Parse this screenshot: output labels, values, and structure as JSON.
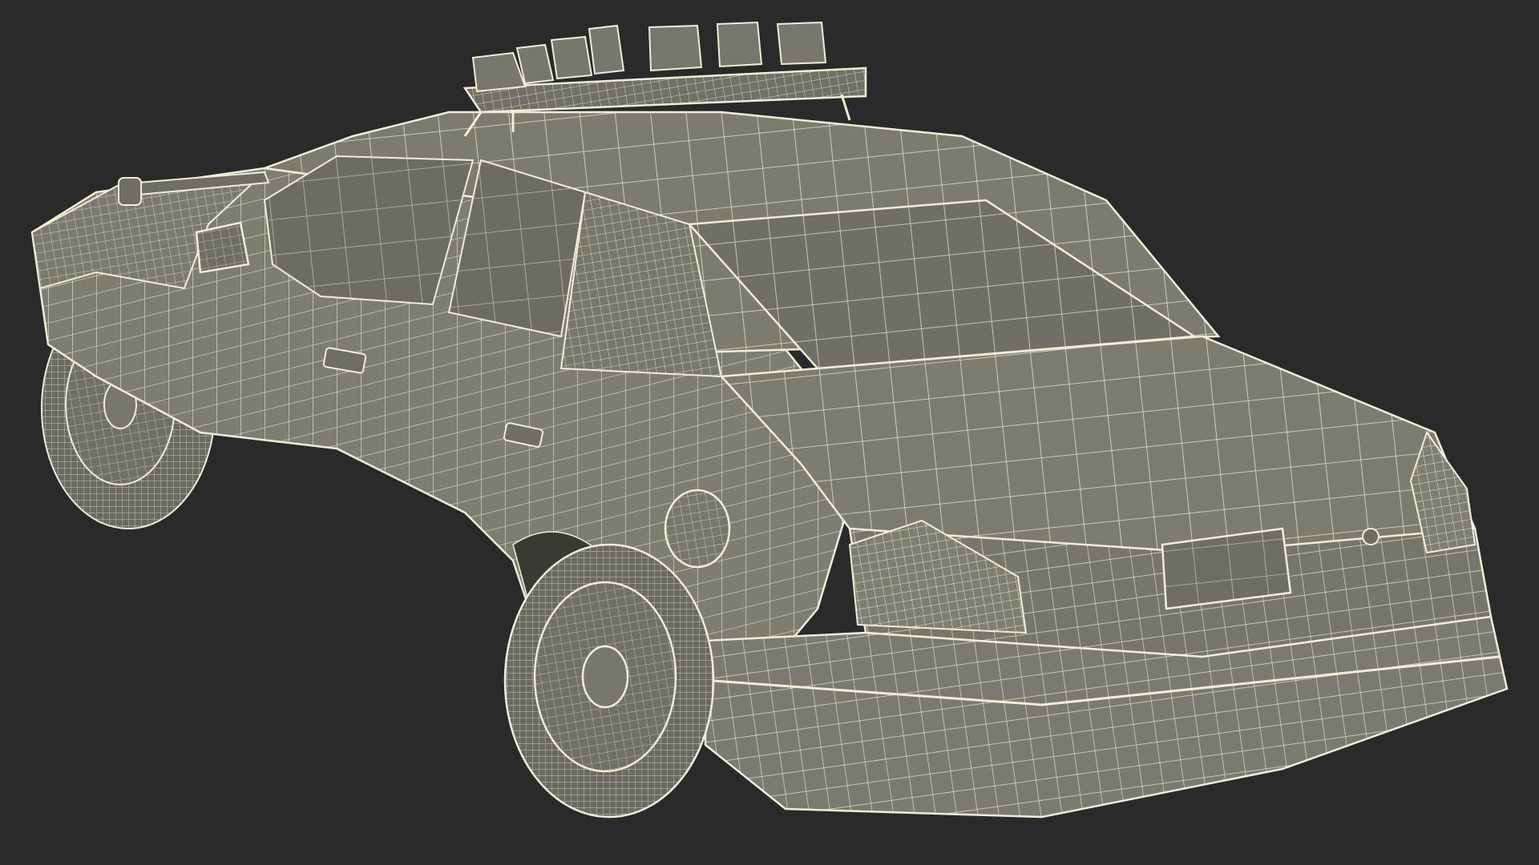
{
  "scene": {
    "background_color": "#2a2a2a",
    "body_color": "#7d7d72",
    "body_dark_color": "#5e5e55",
    "glass_color": "#6c6c63",
    "wire_color": "#eeeed8",
    "tire_color": "#6a6a62",
    "subject": "wireframe-police-car-rear-three-quarter"
  }
}
